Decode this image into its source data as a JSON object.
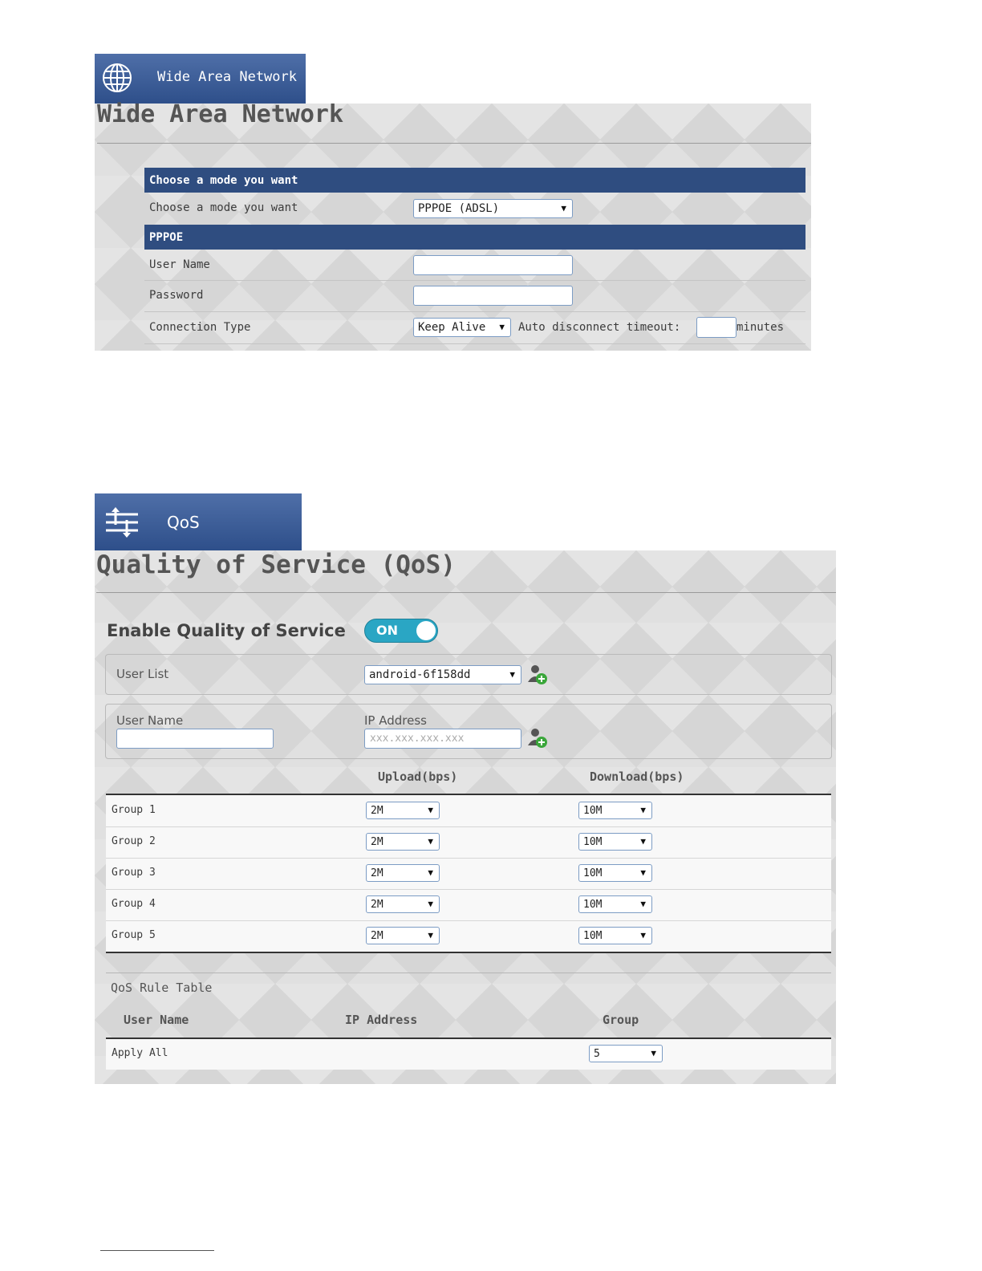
{
  "wan": {
    "tab_label": "Wide Area Network",
    "tab_icon": "globe-icon",
    "title": "Wide Area Network",
    "section_mode": "Choose a mode you want",
    "mode_label": "Choose a mode you want",
    "mode_value": "PPPOE (ADSL)",
    "section_pppoe": "PPPOE",
    "username_label": "User Name",
    "username_value": "",
    "password_label": "Password",
    "password_value": "",
    "conn_type_label": "Connection Type",
    "conn_type_value": "Keep Alive",
    "auto_disconnect_label": "Auto disconnect timeout:",
    "timeout_value": "",
    "minutes_label": "minutes"
  },
  "qos": {
    "tab_label": "QoS",
    "tab_icon": "qos-sliders-icon",
    "title": "Quality of Service (QoS)",
    "enable_label": "Enable Quality of Service",
    "toggle_label": "ON",
    "toggle_state": "on",
    "user_list_label": "User List",
    "user_list_value": "android-6f158dd",
    "user_name_label": "User Name",
    "user_name_value": "",
    "ip_label": "IP Address",
    "ip_placeholder": "xxx.xxx.xxx.xxx",
    "upload_header": "Upload(bps)",
    "download_header": "Download(bps)",
    "groups": [
      {
        "name": "Group 1",
        "upload": "2M",
        "download": "10M"
      },
      {
        "name": "Group 2",
        "upload": "2M",
        "download": "10M"
      },
      {
        "name": "Group 3",
        "upload": "2M",
        "download": "10M"
      },
      {
        "name": "Group 4",
        "upload": "2M",
        "download": "10M"
      },
      {
        "name": "Group 5",
        "upload": "2M",
        "download": "10M"
      }
    ],
    "rule_table_title": "QoS Rule Table",
    "rule_headers": {
      "user_name": "User Name",
      "ip_address": "IP Address",
      "group": "Group"
    },
    "rules": [
      {
        "user_name": "Apply All",
        "ip_address": "",
        "group": "5"
      }
    ]
  },
  "colors": {
    "header_blue": "#2f4d80",
    "toggle_on": "#2aa6c4"
  }
}
